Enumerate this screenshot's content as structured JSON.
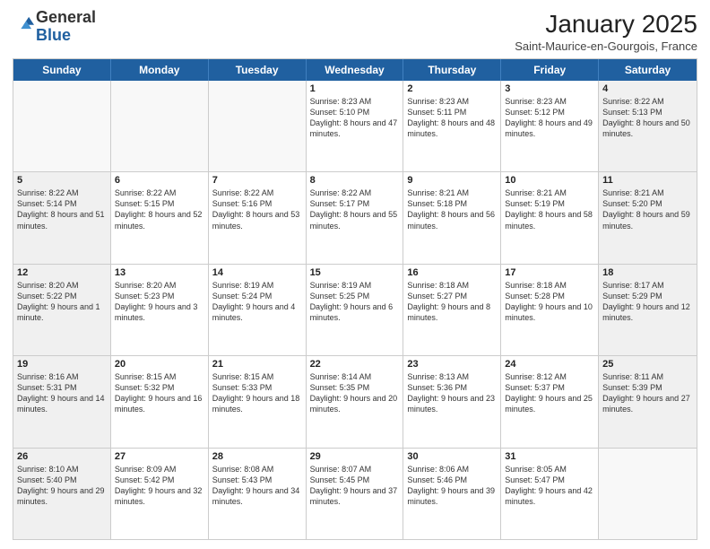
{
  "logo": {
    "general": "General",
    "blue": "Blue"
  },
  "header": {
    "title": "January 2025",
    "location": "Saint-Maurice-en-Gourgois, France"
  },
  "weekdays": [
    "Sunday",
    "Monday",
    "Tuesday",
    "Wednesday",
    "Thursday",
    "Friday",
    "Saturday"
  ],
  "rows": [
    [
      {
        "day": "",
        "text": "",
        "empty": true
      },
      {
        "day": "",
        "text": "",
        "empty": true
      },
      {
        "day": "",
        "text": "",
        "empty": true
      },
      {
        "day": "1",
        "text": "Sunrise: 8:23 AM\nSunset: 5:10 PM\nDaylight: 8 hours and 47 minutes.",
        "empty": false
      },
      {
        "day": "2",
        "text": "Sunrise: 8:23 AM\nSunset: 5:11 PM\nDaylight: 8 hours and 48 minutes.",
        "empty": false
      },
      {
        "day": "3",
        "text": "Sunrise: 8:23 AM\nSunset: 5:12 PM\nDaylight: 8 hours and 49 minutes.",
        "empty": false
      },
      {
        "day": "4",
        "text": "Sunrise: 8:22 AM\nSunset: 5:13 PM\nDaylight: 8 hours and 50 minutes.",
        "empty": false
      }
    ],
    [
      {
        "day": "5",
        "text": "Sunrise: 8:22 AM\nSunset: 5:14 PM\nDaylight: 8 hours and 51 minutes.",
        "empty": false
      },
      {
        "day": "6",
        "text": "Sunrise: 8:22 AM\nSunset: 5:15 PM\nDaylight: 8 hours and 52 minutes.",
        "empty": false
      },
      {
        "day": "7",
        "text": "Sunrise: 8:22 AM\nSunset: 5:16 PM\nDaylight: 8 hours and 53 minutes.",
        "empty": false
      },
      {
        "day": "8",
        "text": "Sunrise: 8:22 AM\nSunset: 5:17 PM\nDaylight: 8 hours and 55 minutes.",
        "empty": false
      },
      {
        "day": "9",
        "text": "Sunrise: 8:21 AM\nSunset: 5:18 PM\nDaylight: 8 hours and 56 minutes.",
        "empty": false
      },
      {
        "day": "10",
        "text": "Sunrise: 8:21 AM\nSunset: 5:19 PM\nDaylight: 8 hours and 58 minutes.",
        "empty": false
      },
      {
        "day": "11",
        "text": "Sunrise: 8:21 AM\nSunset: 5:20 PM\nDaylight: 8 hours and 59 minutes.",
        "empty": false
      }
    ],
    [
      {
        "day": "12",
        "text": "Sunrise: 8:20 AM\nSunset: 5:22 PM\nDaylight: 9 hours and 1 minute.",
        "empty": false
      },
      {
        "day": "13",
        "text": "Sunrise: 8:20 AM\nSunset: 5:23 PM\nDaylight: 9 hours and 3 minutes.",
        "empty": false
      },
      {
        "day": "14",
        "text": "Sunrise: 8:19 AM\nSunset: 5:24 PM\nDaylight: 9 hours and 4 minutes.",
        "empty": false
      },
      {
        "day": "15",
        "text": "Sunrise: 8:19 AM\nSunset: 5:25 PM\nDaylight: 9 hours and 6 minutes.",
        "empty": false
      },
      {
        "day": "16",
        "text": "Sunrise: 8:18 AM\nSunset: 5:27 PM\nDaylight: 9 hours and 8 minutes.",
        "empty": false
      },
      {
        "day": "17",
        "text": "Sunrise: 8:18 AM\nSunset: 5:28 PM\nDaylight: 9 hours and 10 minutes.",
        "empty": false
      },
      {
        "day": "18",
        "text": "Sunrise: 8:17 AM\nSunset: 5:29 PM\nDaylight: 9 hours and 12 minutes.",
        "empty": false
      }
    ],
    [
      {
        "day": "19",
        "text": "Sunrise: 8:16 AM\nSunset: 5:31 PM\nDaylight: 9 hours and 14 minutes.",
        "empty": false
      },
      {
        "day": "20",
        "text": "Sunrise: 8:15 AM\nSunset: 5:32 PM\nDaylight: 9 hours and 16 minutes.",
        "empty": false
      },
      {
        "day": "21",
        "text": "Sunrise: 8:15 AM\nSunset: 5:33 PM\nDaylight: 9 hours and 18 minutes.",
        "empty": false
      },
      {
        "day": "22",
        "text": "Sunrise: 8:14 AM\nSunset: 5:35 PM\nDaylight: 9 hours and 20 minutes.",
        "empty": false
      },
      {
        "day": "23",
        "text": "Sunrise: 8:13 AM\nSunset: 5:36 PM\nDaylight: 9 hours and 23 minutes.",
        "empty": false
      },
      {
        "day": "24",
        "text": "Sunrise: 8:12 AM\nSunset: 5:37 PM\nDaylight: 9 hours and 25 minutes.",
        "empty": false
      },
      {
        "day": "25",
        "text": "Sunrise: 8:11 AM\nSunset: 5:39 PM\nDaylight: 9 hours and 27 minutes.",
        "empty": false
      }
    ],
    [
      {
        "day": "26",
        "text": "Sunrise: 8:10 AM\nSunset: 5:40 PM\nDaylight: 9 hours and 29 minutes.",
        "empty": false
      },
      {
        "day": "27",
        "text": "Sunrise: 8:09 AM\nSunset: 5:42 PM\nDaylight: 9 hours and 32 minutes.",
        "empty": false
      },
      {
        "day": "28",
        "text": "Sunrise: 8:08 AM\nSunset: 5:43 PM\nDaylight: 9 hours and 34 minutes.",
        "empty": false
      },
      {
        "day": "29",
        "text": "Sunrise: 8:07 AM\nSunset: 5:45 PM\nDaylight: 9 hours and 37 minutes.",
        "empty": false
      },
      {
        "day": "30",
        "text": "Sunrise: 8:06 AM\nSunset: 5:46 PM\nDaylight: 9 hours and 39 minutes.",
        "empty": false
      },
      {
        "day": "31",
        "text": "Sunrise: 8:05 AM\nSunset: 5:47 PM\nDaylight: 9 hours and 42 minutes.",
        "empty": false
      },
      {
        "day": "",
        "text": "",
        "empty": true
      }
    ]
  ]
}
